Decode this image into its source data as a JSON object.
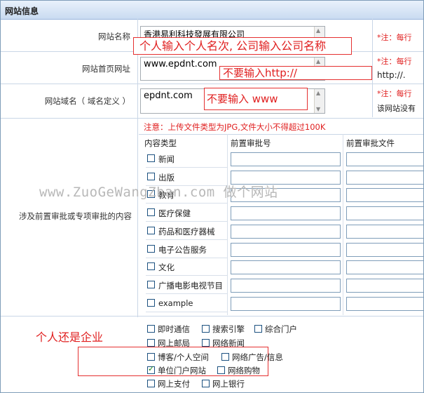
{
  "section_title": "网站信息",
  "fields": {
    "site_name": {
      "label": "网站名称",
      "value": "香港易利科技發展有限公司",
      "annotation": "个人输入个人名次, 公司输入公司名称",
      "note": "*注：每行"
    },
    "homepage": {
      "label": "网站首页网址",
      "value": "www.epdnt.com",
      "annotation": "不要输入http://",
      "note": "*注：每行",
      "note2": "http://."
    },
    "domain": {
      "label": "网站域名（ 域名定义 ）",
      "value": "epdnt.com",
      "annotation": "不要输入  www",
      "note": "*注：每行",
      "note2": "该网站没有"
    }
  },
  "approval": {
    "label": "涉及前置审批或专项审批的内容",
    "warning": "注意：上传文件类型为JPG,文件大小不得超过100K",
    "col_type": "内容类型",
    "col_number": "前置审批号",
    "col_file": "前置审批文件",
    "types": [
      "新闻",
      "出版",
      "教育",
      "医疗保健",
      "药品和医疗器械",
      "电子公告服务",
      "文化",
      "广播电影电视节目",
      "example"
    ]
  },
  "services": {
    "annotation": "个人还是企业",
    "rows": [
      [
        {
          "label": "即时通信",
          "checked": false
        },
        {
          "label": "搜索引擎",
          "checked": false
        },
        {
          "label": "综合门户",
          "checked": false
        }
      ],
      [
        {
          "label": "网上邮局",
          "checked": false
        },
        {
          "label": "网络新闻",
          "checked": false
        }
      ],
      [
        {
          "label": "博客/个人空间",
          "checked": false
        },
        {
          "label": "网络广告/信息",
          "checked": false
        }
      ],
      [
        {
          "label": "单位门户网站",
          "checked": true
        },
        {
          "label": "网络购物",
          "checked": false
        }
      ],
      [
        {
          "label": "网上支付",
          "checked": false
        },
        {
          "label": "网上银行",
          "checked": false
        }
      ]
    ]
  },
  "watermark": "www.ZuoGeWangZhan.com 做个网站",
  "colors": {
    "accent_red": "#e02020",
    "header_bg": "#c9dbf1",
    "border": "#7f9db9"
  }
}
